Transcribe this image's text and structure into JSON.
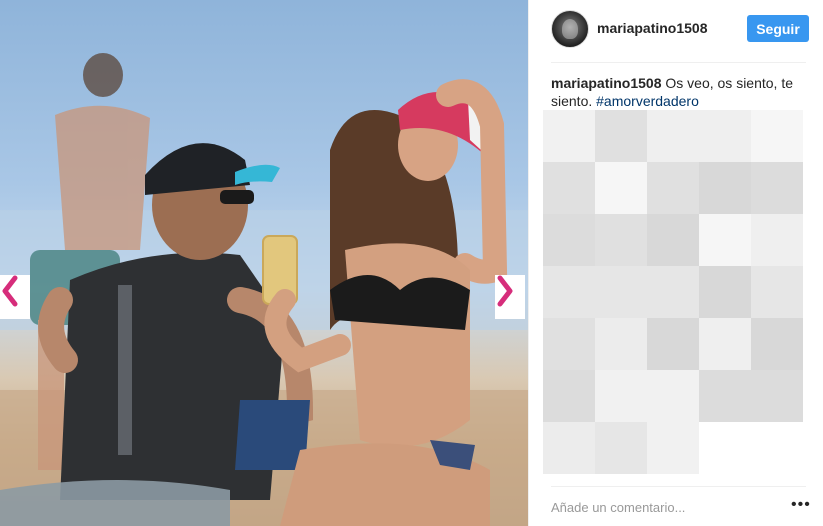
{
  "post": {
    "username": "mariapatino1508",
    "follow_label": "Seguir",
    "caption_text": " Os veo, os siento, te siento. ",
    "hashtag": "#amorverdadero",
    "comment_placeholder": "Añade un comentario...",
    "more_label": "•••"
  },
  "photo": {
    "subject": "couple-on-beach"
  },
  "nav": {
    "prev_icon": "chevron-left-icon",
    "next_icon": "chevron-right-icon",
    "arrow_color": "#d62d7b"
  },
  "colors": {
    "follow_bg": "#3897f0",
    "hashtag": "#003569",
    "text": "#262626"
  }
}
